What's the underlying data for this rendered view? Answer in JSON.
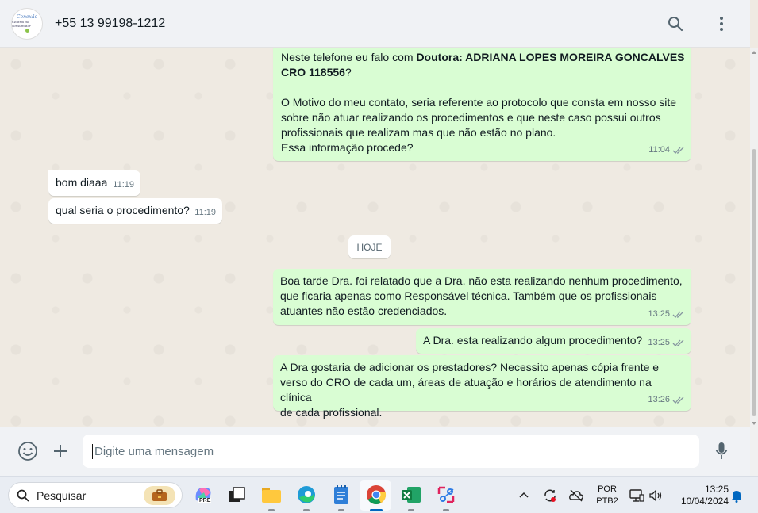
{
  "header": {
    "contact_name": "+55 13 99198-1212",
    "avatar_text_1": "Conexão",
    "avatar_text_2": "Central do consumidor"
  },
  "messages": [
    {
      "direction": "outgoing",
      "line1_prefix": "Neste telefone eu falo com ",
      "line1_bold": "Doutora: ADRIANA LOPES MOREIRA GONCALVES",
      "line2_bold": "CRO 118556",
      "line2_suffix": "?",
      "line3": "O Motivo do meu contato, seria referente ao protocolo que consta em nosso site",
      "line4": "sobre não atuar realizando os procedimentos e que neste caso possui outros",
      "line5": "profissionais que realizam mas que não estão no plano.",
      "line6": "Essa informação procede?",
      "time": "11:04",
      "status": "read"
    },
    {
      "direction": "incoming",
      "text": "bom diaaa",
      "time": "11:19"
    },
    {
      "direction": "incoming",
      "text": "qual seria o procedimento?",
      "time": "11:19"
    },
    {
      "direction": "outgoing",
      "line1": "Boa tarde Dra. foi relatado que a Dra. não esta realizando nenhum procedimento,",
      "line2": "que ficaria apenas como Responsável técnica. Também que os profissionais",
      "line3": "atuantes não estão credenciados.",
      "time": "13:25",
      "status": "read"
    },
    {
      "direction": "outgoing",
      "text": "A Dra. esta realizando algum procedimento?",
      "time": "13:25",
      "status": "read"
    },
    {
      "direction": "outgoing",
      "line1": "A Dra gostaria de adicionar os prestadores? Necessito apenas cópia frente e",
      "line2": "verso do CRO de cada um, áreas de atuação e horários de atendimento na clínica",
      "line3": "de cada profissional.",
      "time": "13:26",
      "status": "read"
    }
  ],
  "day_separator": "HOJE",
  "composer": {
    "placeholder": "Digite uma mensagem"
  },
  "taskbar": {
    "search_placeholder": "Pesquisar",
    "apps": [
      "copilot-icon",
      "task-view-icon",
      "file-explorer-icon",
      "edge-icon",
      "notepad-icon",
      "chrome-icon",
      "excel-icon",
      "snipping-tool-icon"
    ],
    "copilot_badge": "PRE",
    "lang_line1": "POR",
    "lang_line2": "PTB2",
    "time": "13:25",
    "date": "10/04/2024"
  },
  "colors": {
    "outgoing_bubble": "#d9fdd3",
    "incoming_bubble": "#ffffff",
    "chat_bg": "#efeae2",
    "read_ticks": "#8696a0"
  }
}
